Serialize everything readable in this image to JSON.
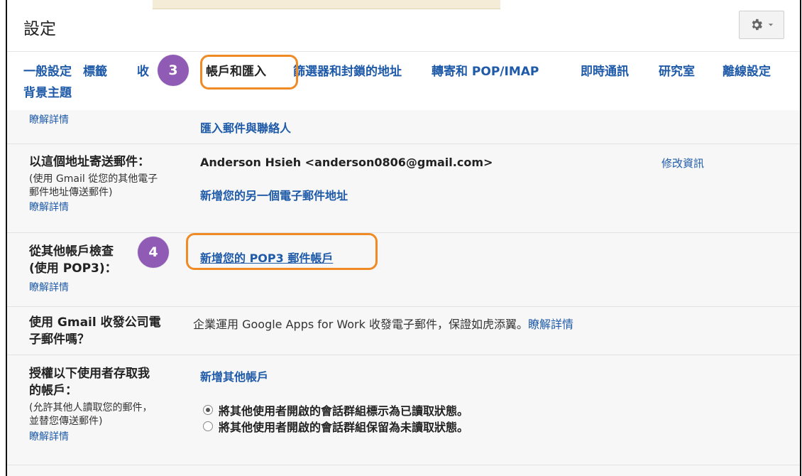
{
  "header": {
    "title": "設定"
  },
  "tabs": [
    {
      "label": "一般設定"
    },
    {
      "label": "標籤"
    },
    {
      "label": "收"
    },
    {
      "label": "帳戶和匯入"
    },
    {
      "label": "篩選器和封鎖的地址"
    },
    {
      "label": "轉寄和 POP/IMAP"
    },
    {
      "label": "即時通訊"
    },
    {
      "label": "研究室"
    },
    {
      "label": "離線設定"
    },
    {
      "label": "背景主題"
    }
  ],
  "badges": {
    "step3": "3",
    "step4": "4"
  },
  "rows": {
    "import": {
      "learn_more": "瞭解詳情",
      "action": "匯入郵件與聯絡人"
    },
    "send_as": {
      "label": "以這個地址寄送郵件：",
      "sublabel_line1": "(使用 Gmail 從您的其他電子",
      "sublabel_line2": "郵件地址傳送郵件)",
      "learn_more": "瞭解詳情",
      "address": "Anderson Hsieh <anderson0806@gmail.com>",
      "edit_info": "修改資訊",
      "add_address": "新增您的另一個電子郵件地址"
    },
    "pop3": {
      "label_line1": "從其他帳戶檢查",
      "label_line2": "(使用 POP3)：",
      "learn_more": "瞭解詳情",
      "add_pop3": "新增您的 POP3 郵件帳戶"
    },
    "work": {
      "label_line1": "使用 Gmail 收發公司電",
      "label_line2": "子郵件嗎？",
      "text": "企業運用 Google Apps for Work 收發電子郵件，保證如虎添翼。",
      "learn_more": "瞭解詳情"
    },
    "grant": {
      "label_line1": "授權以下使用者存取我",
      "label_line2": "的帳戶：",
      "sublabel_line1": "(允許其他人讀取您的郵件，",
      "sublabel_line2": "並替您傳送郵件)",
      "learn_more": "瞭解詳情",
      "add_account": "新增其他帳戶",
      "option1": "將其他使用者開啟的會話群組標示為已讀取狀態。",
      "option2": "將其他使用者開啟的會話群組保留為未讀取狀態。"
    }
  },
  "icons": {
    "gear": "gear-icon",
    "dropdown": "chevron-down-icon"
  },
  "colors": {
    "link": "#1e5aa8",
    "highlight": "#f08a24",
    "badge": "#8f5bb5"
  }
}
